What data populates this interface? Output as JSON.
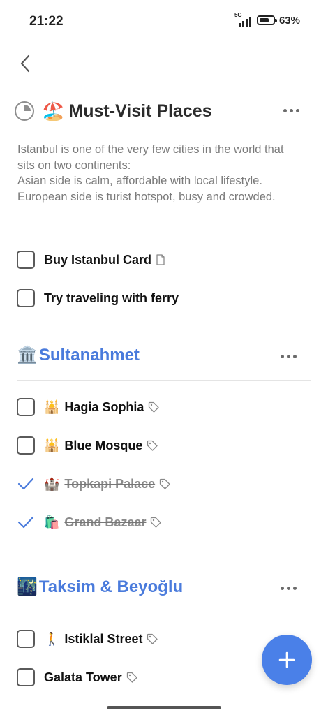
{
  "status_bar": {
    "time": "21:22",
    "network": "5G",
    "battery_percent": "63%",
    "battery_level": 0.63
  },
  "header": {
    "back_icon": "chevron-left-icon",
    "title_emoji": "🏖️",
    "title": "Must-Visit Places",
    "progress_icon": "progress-ring-icon",
    "more_icon": "more-horizontal-icon"
  },
  "description": "Istanbul is one of the very few cities in the world that sits on two continents:\nAsian side is calm, affordable with local lifestyle.\nEuropean side is turist hotspot, busy and crowded.",
  "tasks": [
    {
      "label": "Buy Istanbul Card",
      "checked": false,
      "meta_icon": "note-icon"
    },
    {
      "label": "Try traveling with ferry",
      "checked": false
    }
  ],
  "sections": [
    {
      "emoji": "🏛️",
      "title": "Sultanahmet",
      "tasks": [
        {
          "emoji": "🕌",
          "label": "Hagia Sophia",
          "checked": false,
          "meta_icon": "tag-icon"
        },
        {
          "emoji": "🕌",
          "label": "Blue Mosque",
          "checked": false,
          "meta_icon": "tag-icon"
        },
        {
          "emoji": "🏰",
          "label": "Topkapi Palace",
          "checked": true,
          "meta_icon": "tag-icon"
        },
        {
          "emoji": "🛍️",
          "label": "Grand Bazaar",
          "checked": true,
          "meta_icon": "tag-icon"
        }
      ]
    },
    {
      "emoji": "🌃",
      "title": "Taksim & Beyoğlu",
      "tasks": [
        {
          "emoji": "🚶",
          "label": "Istiklal Street",
          "checked": false,
          "meta_icon": "tag-icon"
        },
        {
          "label": "Galata Tower",
          "checked": false,
          "meta_icon": "tag-icon"
        }
      ]
    }
  ],
  "fab": {
    "icon": "plus-icon"
  },
  "colors": {
    "accent": "#4a7bdc",
    "fab": "#4a80e8",
    "check": "#4a7bdc",
    "text": "#111111",
    "muted": "#7a7a7a"
  }
}
